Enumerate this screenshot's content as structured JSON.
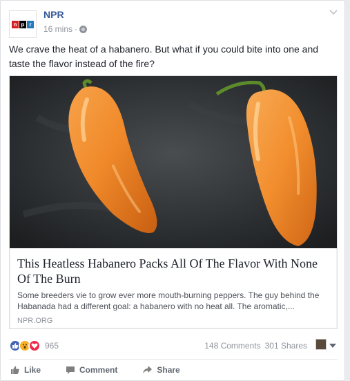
{
  "post": {
    "page_name": "NPR",
    "time": "16 mins",
    "separator": "·",
    "text": "We crave the heat of a habanero. But what if you could bite into one and taste the flavor instead of the fire?"
  },
  "logo": {
    "n": "n",
    "p": "p",
    "r": "r",
    "colors": {
      "n": "#d62021",
      "p": "#000000",
      "r": "#237bbd"
    }
  },
  "link": {
    "title": "This Heatless Habanero Packs All Of The Flavor With None Of The Burn",
    "description": "Some breeders vie to grow ever more mouth-burning peppers. The guy behind the Habanada had a different goal: a habanero with no heat all. The aromatic,...",
    "domain": "NPR.ORG"
  },
  "stats": {
    "reaction_count": "965",
    "reactions": [
      "like-icon",
      "wow-icon",
      "love-icon"
    ],
    "comments": "148 Comments",
    "shares": "301 Shares"
  },
  "actions": {
    "like": "Like",
    "comment": "Comment",
    "share": "Share"
  },
  "colors": {
    "link_blue": "#365899",
    "meta_gray": "#90949c",
    "like_blue": "#4267b2",
    "wow_yellow": "#f7b125",
    "love_red": "#f0284a"
  }
}
